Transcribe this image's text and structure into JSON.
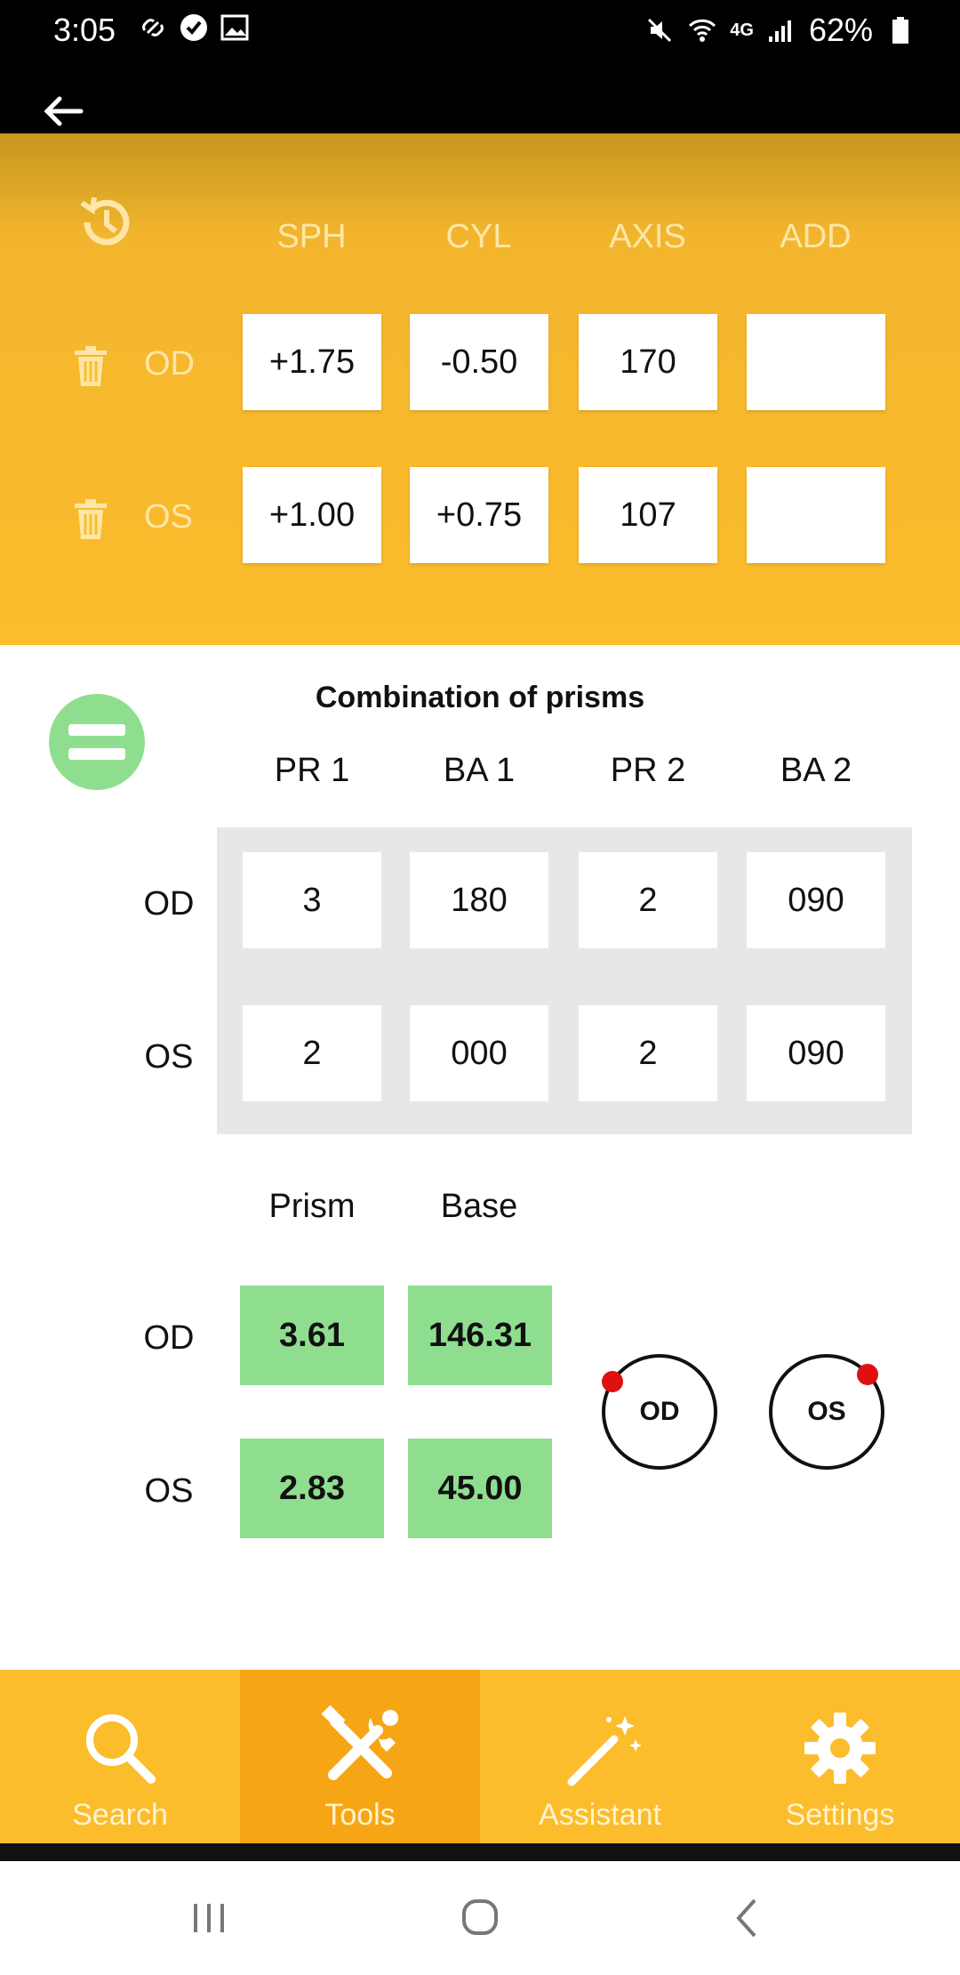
{
  "status_bar": {
    "time": "3:05",
    "battery": "62%",
    "network": "4G"
  },
  "header": {
    "back_icon": "arrow-left-icon"
  },
  "rx": {
    "columns": [
      "SPH",
      "CYL",
      "AXIS",
      "ADD"
    ],
    "rows": [
      {
        "label": "OD",
        "values": [
          "+1.75",
          "-0.50",
          "170",
          ""
        ]
      },
      {
        "label": "OS",
        "values": [
          "+1.00",
          "+0.75",
          "107",
          ""
        ]
      }
    ]
  },
  "prism": {
    "title": "Combination of prisms",
    "columns": [
      "PR 1",
      "BA 1",
      "PR 2",
      "BA 2"
    ],
    "rows": [
      {
        "label": "OD",
        "values": [
          "3",
          "180",
          "2",
          "090"
        ]
      },
      {
        "label": "OS",
        "values": [
          "2",
          "000",
          "2",
          "090"
        ]
      }
    ],
    "result_columns": [
      "Prism",
      "Base"
    ],
    "results": [
      {
        "label": "OD",
        "prism": "3.61",
        "base": "146.31"
      },
      {
        "label": "OS",
        "prism": "2.83",
        "base": "45.00"
      }
    ],
    "diagrams": [
      {
        "label": "OD"
      },
      {
        "label": "OS"
      }
    ]
  },
  "bottom_nav": {
    "items": [
      {
        "label": "Search",
        "icon": "search-icon",
        "active": false
      },
      {
        "label": "Tools",
        "icon": "tools-icon",
        "active": true
      },
      {
        "label": "Assistant",
        "icon": "magic-wand-icon",
        "active": false
      },
      {
        "label": "Settings",
        "icon": "gear-icon",
        "active": false
      }
    ]
  },
  "colors": {
    "accent": "#fbbd2c",
    "active_tab": "#f6a614",
    "result_green": "#8fde8f",
    "marker_red": "#e01010"
  }
}
